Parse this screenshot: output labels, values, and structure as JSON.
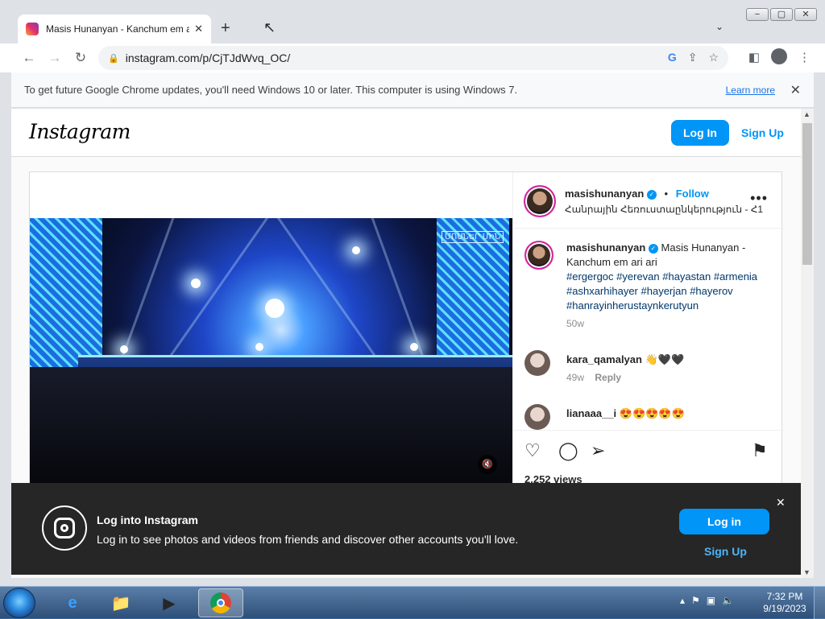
{
  "browser": {
    "tab_title": "Masis Hunanyan - Kanchum em a",
    "url": "instagram.com/p/CjTJdWvq_OC/",
    "newtab_symbol": "+",
    "window_controls": [
      "−",
      "▢",
      "✕"
    ]
  },
  "infobar": {
    "message": "To get future Google Chrome updates, you'll need Windows 10 or later. This computer is using Windows 7.",
    "learn_more": "Learn more"
  },
  "instagram": {
    "logo": "Instagram",
    "login": "Log In",
    "signup": "Sign Up"
  },
  "post": {
    "username": "masishunanyan",
    "follow": "Follow",
    "location": "Հանրային Հեռուստաընկերություն - Հ1",
    "watermark": "ՄՈՍՆԵՐ ՄԻՆ",
    "caption_title": "Masis Hunanyan - Kanchum em ari ari",
    "caption_tags": "#ergergoc #yerevan #hayastan #armenia #ashxarhihayer #hayerjan #hayerov #hanrayinherustaynkerutyun",
    "caption_age": "50w",
    "comments": [
      {
        "user": "kara_qamalyan",
        "text": "👋🖤🖤",
        "age": "49w",
        "reply": "Reply"
      },
      {
        "user": "lianaaa__i",
        "text": "😍😍😍😍😍"
      }
    ],
    "views": "2,252 views"
  },
  "banner": {
    "title": "Log into Instagram",
    "subtitle": "Log in to see photos and videos from friends and discover other accounts you'll love.",
    "login": "Log in",
    "signup": "Sign Up"
  },
  "taskbar": {
    "time": "7:32 PM",
    "date": "9/19/2023"
  },
  "colors": {
    "ig_blue": "#0095f6",
    "banner_bg": "#262626"
  },
  "icons": [
    "instagram-favicon",
    "close-icon",
    "back-icon",
    "forward-icon",
    "reload-icon",
    "lock-icon",
    "google-lens-icon",
    "share-icon",
    "star-icon",
    "sidepanel-icon",
    "profile-icon",
    "menu-icon",
    "verified-icon",
    "more-icon",
    "mute-icon",
    "heart-icon",
    "comment-icon",
    "send-icon",
    "bookmark-icon",
    "instagram-logo-icon",
    "ie-icon",
    "folder-icon",
    "media-player-icon",
    "chrome-icon"
  ]
}
